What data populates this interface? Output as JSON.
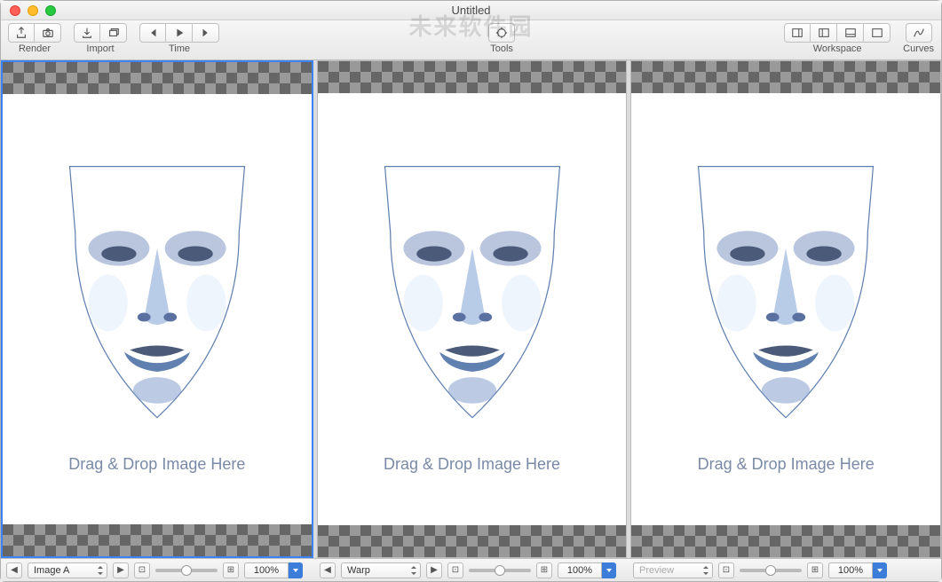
{
  "window": {
    "title": "Untitled"
  },
  "toolbar": {
    "render_label": "Render",
    "import_label": "Import",
    "time_label": "Time",
    "tools_label": "Tools",
    "workspace_label": "Workspace",
    "curves_label": "Curves"
  },
  "panes": [
    {
      "drop_text": "Drag & Drop Image Here",
      "selector": "Image A",
      "zoom": "100%",
      "active": true
    },
    {
      "drop_text": "Drag & Drop Image Here",
      "selector": "Warp",
      "zoom": "100%",
      "active": false
    },
    {
      "drop_text": "Drag & Drop Image Here",
      "selector": "Preview",
      "zoom": "100%",
      "active": false,
      "dim": true
    }
  ],
  "watermark": "未来软件园"
}
